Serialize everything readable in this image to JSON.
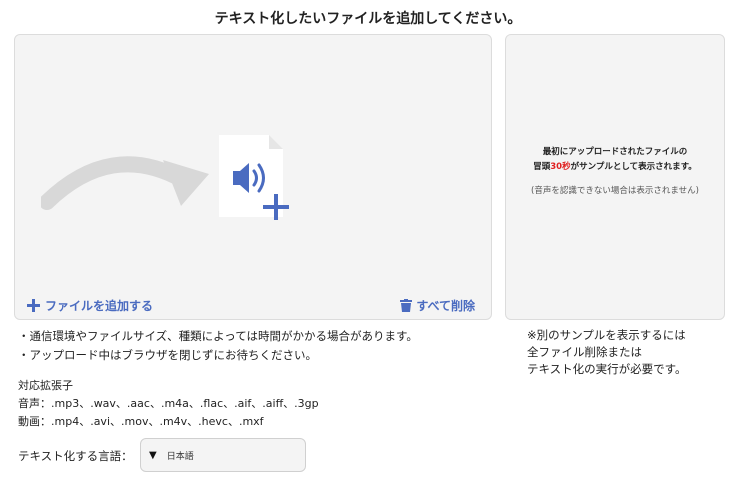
{
  "header": {
    "title": "テキスト化したいファイルを追加してください。"
  },
  "dropzone": {
    "add_label": "ファイルを追加する",
    "delete_label": "すべて削除",
    "accent_color": "#4a6bc0"
  },
  "sample": {
    "line1": "最初にアップロードされたファイルの",
    "line2_before": "冒頭",
    "line2_highlight": "30秒",
    "line2_after": "がサンプルとして表示されます。",
    "sub": "(音声を認識できない場合は表示されません)"
  },
  "notes": [
    "・通信環境やファイルサイズ、種類によっては時間がかかる場合があります。",
    "・アップロード中はブラウザを閉じずにお待ちください。"
  ],
  "sample_note": [
    "※別のサンプルを表示するには",
    "全ファイル削除または",
    "テキスト化の実行が必要です。"
  ],
  "formats": {
    "heading": "対応拡張子",
    "audio": "音声：.mp3、.wav、.aac、.m4a、.flac、.aif、.aiff、.3gp",
    "video": "動画：.mp4、.avi、.mov、.m4v、.hevc、.mxf"
  },
  "language": {
    "label": "テキスト化する言語：",
    "value": "日本語"
  }
}
